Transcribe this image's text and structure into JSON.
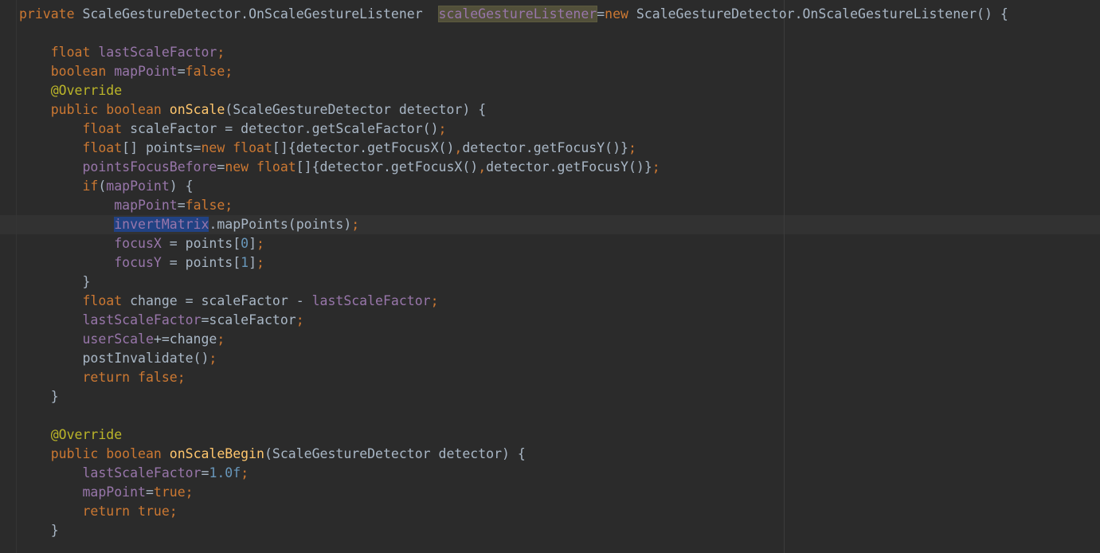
{
  "editor": {
    "lines": [
      [
        [
          "k",
          "private "
        ],
        [
          "p",
          "ScaleGestureDetector.OnScaleGestureListener  "
        ],
        [
          "f hl-usage",
          "scaleGestureListener"
        ],
        [
          "p",
          "="
        ],
        [
          "k",
          "new "
        ],
        [
          "p",
          "ScaleGestureDetector.OnScaleGestureListener() {"
        ]
      ],
      [],
      [
        [
          "p",
          "    "
        ],
        [
          "k",
          "float "
        ],
        [
          "f",
          "lastScaleFactor"
        ],
        [
          "k",
          ";"
        ]
      ],
      [
        [
          "p",
          "    "
        ],
        [
          "k",
          "boolean "
        ],
        [
          "f",
          "mapPoint"
        ],
        [
          "p",
          "="
        ],
        [
          "k",
          "false;"
        ]
      ],
      [
        [
          "p",
          "    "
        ],
        [
          "a",
          "@Override"
        ]
      ],
      [
        [
          "p",
          "    "
        ],
        [
          "k",
          "public boolean "
        ],
        [
          "m",
          "onScale"
        ],
        [
          "p",
          "(ScaleGestureDetector detector) {"
        ]
      ],
      [
        [
          "p",
          "        "
        ],
        [
          "k",
          "float "
        ],
        [
          "p",
          "scaleFactor = detector.getScaleFactor()"
        ],
        [
          "k",
          ";"
        ]
      ],
      [
        [
          "p",
          "        "
        ],
        [
          "k",
          "float"
        ],
        [
          "p",
          "[] points="
        ],
        [
          "k",
          "new float"
        ],
        [
          "p",
          "[]{detector.getFocusX()"
        ],
        [
          "k",
          ","
        ],
        [
          "p",
          "detector.getFocusY()}"
        ],
        [
          "k",
          ";"
        ]
      ],
      [
        [
          "p",
          "        "
        ],
        [
          "f",
          "pointsFocusBefore"
        ],
        [
          "p",
          "="
        ],
        [
          "k",
          "new float"
        ],
        [
          "p",
          "[]{detector.getFocusX()"
        ],
        [
          "k",
          ","
        ],
        [
          "p",
          "detector.getFocusY()}"
        ],
        [
          "k",
          ";"
        ]
      ],
      [
        [
          "p",
          "        "
        ],
        [
          "k",
          "if"
        ],
        [
          "p",
          "("
        ],
        [
          "f",
          "mapPoint"
        ],
        [
          "p",
          ") {"
        ]
      ],
      [
        [
          "p",
          "            "
        ],
        [
          "f",
          "mapPoint"
        ],
        [
          "p",
          "="
        ],
        [
          "k",
          "false;"
        ]
      ],
      [
        [
          "p",
          "            "
        ],
        [
          "f hl-select",
          "invertMatrix"
        ],
        [
          "p",
          ".mapPoints(points)"
        ],
        [
          "k",
          ";"
        ]
      ],
      [
        [
          "p",
          "            "
        ],
        [
          "f",
          "focusX "
        ],
        [
          "p",
          "= points["
        ],
        [
          "n",
          "0"
        ],
        [
          "p",
          "]"
        ],
        [
          "k",
          ";"
        ]
      ],
      [
        [
          "p",
          "            "
        ],
        [
          "f",
          "focusY "
        ],
        [
          "p",
          "= points["
        ],
        [
          "n",
          "1"
        ],
        [
          "p",
          "]"
        ],
        [
          "k",
          ";"
        ]
      ],
      [
        [
          "p",
          "        }"
        ]
      ],
      [
        [
          "p",
          "        "
        ],
        [
          "k",
          "float "
        ],
        [
          "p",
          "change = scaleFactor - "
        ],
        [
          "f",
          "lastScaleFactor"
        ],
        [
          "k",
          ";"
        ]
      ],
      [
        [
          "p",
          "        "
        ],
        [
          "f",
          "lastScaleFactor"
        ],
        [
          "p",
          "=scaleFactor"
        ],
        [
          "k",
          ";"
        ]
      ],
      [
        [
          "p",
          "        "
        ],
        [
          "f",
          "userScale"
        ],
        [
          "p",
          "+=change"
        ],
        [
          "k",
          ";"
        ]
      ],
      [
        [
          "p",
          "        postInvalidate()"
        ],
        [
          "k",
          ";"
        ]
      ],
      [
        [
          "p",
          "        "
        ],
        [
          "k",
          "return false;"
        ]
      ],
      [
        [
          "p",
          "    }"
        ]
      ],
      [],
      [
        [
          "p",
          "    "
        ],
        [
          "a",
          "@Override"
        ]
      ],
      [
        [
          "p",
          "    "
        ],
        [
          "k",
          "public boolean "
        ],
        [
          "m",
          "onScaleBegin"
        ],
        [
          "p",
          "(ScaleGestureDetector detector) {"
        ]
      ],
      [
        [
          "p",
          "        "
        ],
        [
          "f",
          "lastScaleFactor"
        ],
        [
          "p",
          "="
        ],
        [
          "n",
          "1.0f"
        ],
        [
          "k",
          ";"
        ]
      ],
      [
        [
          "p",
          "        "
        ],
        [
          "f",
          "mapPoint"
        ],
        [
          "p",
          "="
        ],
        [
          "k",
          "true;"
        ]
      ],
      [
        [
          "p",
          "        "
        ],
        [
          "k",
          "return true;"
        ]
      ],
      [
        [
          "p",
          "    }"
        ]
      ]
    ]
  }
}
